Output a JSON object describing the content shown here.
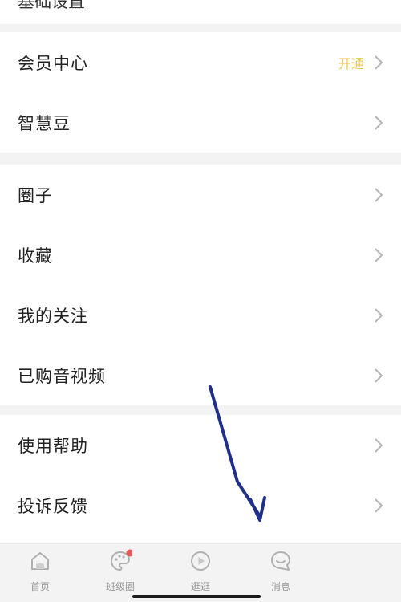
{
  "top_partial": {
    "label": "基础设置"
  },
  "menu": {
    "group1": [
      {
        "label": "会员中心",
        "badge": "开通"
      },
      {
        "label": "智慧豆"
      }
    ],
    "group2": [
      {
        "label": "圈子"
      },
      {
        "label": "收藏"
      },
      {
        "label": "我的关注"
      },
      {
        "label": "已购音视频"
      }
    ],
    "group3": [
      {
        "label": "使用帮助"
      },
      {
        "label": "投诉反馈"
      }
    ]
  },
  "tabbar": {
    "items": [
      {
        "label": "首页",
        "icon": "home-icon"
      },
      {
        "label": "班级圈",
        "icon": "palette-icon",
        "notification": true
      },
      {
        "label": "逛逛",
        "icon": "play-icon"
      },
      {
        "label": "消息",
        "icon": "message-icon"
      }
    ]
  },
  "colors": {
    "badge": "#e9c64d",
    "arrow_annotation": "#1f2f8a",
    "notification_dot": "#e35a5a"
  }
}
